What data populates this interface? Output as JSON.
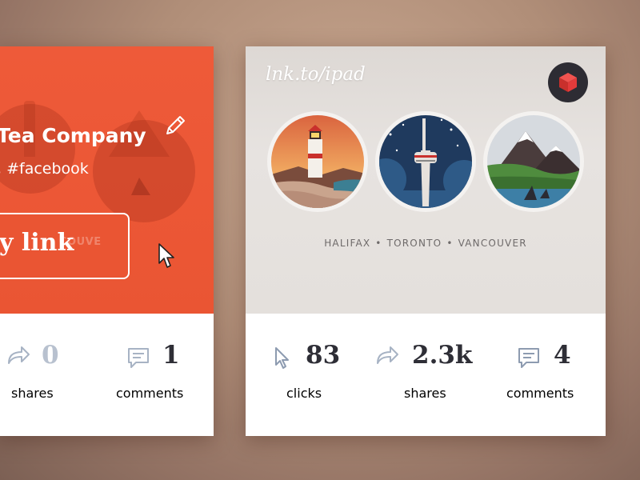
{
  "left_card": {
    "company_name": "Tea Company",
    "tags": ", #facebook",
    "copy_link_label": "py link",
    "ghost_button_text": "COUVE",
    "stats": [
      {
        "value": "0",
        "label": "shares",
        "icon": "share-arrow-icon"
      },
      {
        "value": "1",
        "label": "comments",
        "icon": "comment-icon"
      }
    ]
  },
  "right_card": {
    "url": "lnk.to/ipad",
    "badge_icon": "red-box-icon",
    "cities": "HALIFAX • TORONTO • VANCOUVER",
    "stats": [
      {
        "value": "83",
        "label": "clicks",
        "icon": "cursor-pointer-icon"
      },
      {
        "value": "2.3k",
        "label": "shares",
        "icon": "share-arrow-icon"
      },
      {
        "value": "4",
        "label": "comments",
        "icon": "comment-icon"
      }
    ]
  },
  "colors": {
    "accent_orange": "#ea5533",
    "dark_text": "#2e2e36",
    "muted_label": "#6b6b72",
    "icon_blue": "#8d9bb0",
    "badge_red": "#e33b3b"
  }
}
